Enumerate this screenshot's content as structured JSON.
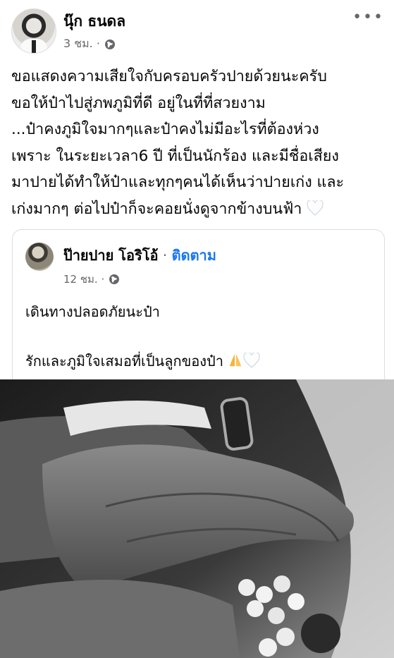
{
  "post": {
    "author": "นุ๊ก ธนดล",
    "time": "3 ชม. ·",
    "more_label": "•••",
    "body_lines": [
      "ขอแสดงความเสียใจกับครอบครัวปายด้วยนะครับ",
      "ขอให้ป๋าไปสู่ภพภูมิที่ดี อยู่ในที่ที่สวยงาม",
      "...ป๋าคงภูมิใจมากๆและป๋าคงไม่มีอะไรที่ต้องห่วง",
      "เพราะ ในระยะเวลา6 ปี ที่เป็นนักร้อง และมีชื่อเสียง",
      "มาปายได้ทำให้ป๋าและทุกๆคนได้เห็นว่าปายเก่ง และ",
      "เก่งมากๆ ต่อไปป๋าก็จะคอยนั่งดูจากข้างบนฟ้า"
    ]
  },
  "shared": {
    "author": "ป๊ายปาย โอริโอ้",
    "separator": " · ",
    "follow_label": "ติดตาม",
    "time": "12 ชม. ·",
    "line1": "เดินทางปลอดภัยนะป๋า",
    "line2": "รักและภูมิใจเสมอที่เป็นลูกของป๋า",
    "emoji_icons": [
      "folded-hands-icon",
      "white-heart-icon"
    ]
  },
  "colors": {
    "accent": "#1877f2",
    "meta": "#65676b",
    "text": "#050505"
  }
}
